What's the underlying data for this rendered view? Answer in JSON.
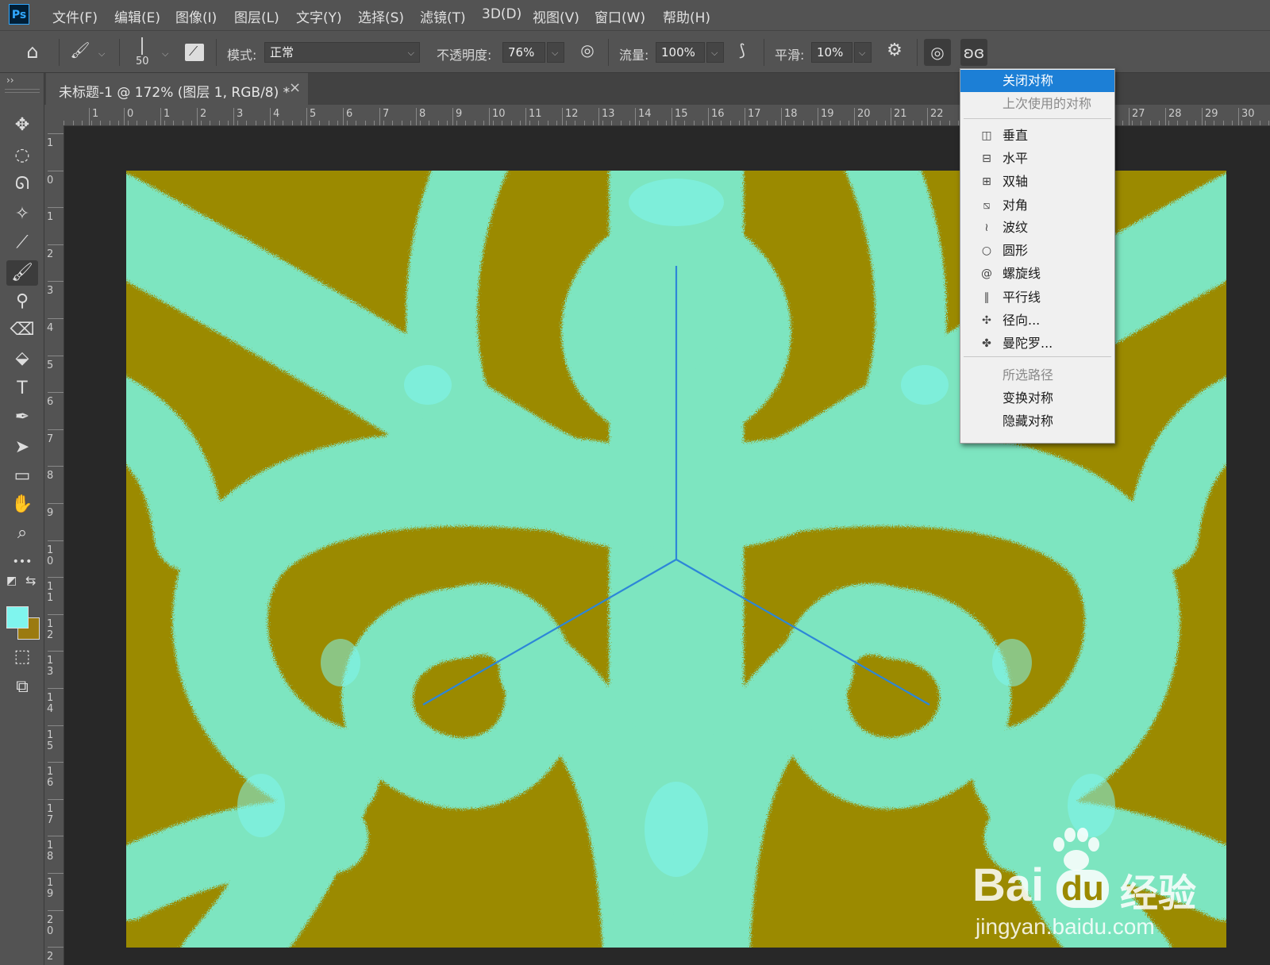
{
  "app": {
    "logo_text": "Ps"
  },
  "menubar": {
    "items": [
      "文件(F)",
      "编辑(E)",
      "图像(I)",
      "图层(L)",
      "文字(Y)",
      "选择(S)",
      "滤镜(T)",
      "3D(D)",
      "视图(V)",
      "窗口(W)",
      "帮助(H)"
    ]
  },
  "options": {
    "brush_size": "50",
    "mode_label": "模式:",
    "mode_value": "正常",
    "opacity_label": "不透明度:",
    "opacity_value": "76%",
    "flow_label": "流量:",
    "flow_value": "100%",
    "smooth_label": "平滑:",
    "smooth_value": "10%"
  },
  "toolbar": {
    "collapse_glyph": "››",
    "tools": [
      {
        "name": "move-tool-icon",
        "glyph": "✥"
      },
      {
        "name": "ellipse-marquee-tool-icon",
        "glyph": "◌"
      },
      {
        "name": "lasso-tool-icon",
        "glyph": "ᘏ"
      },
      {
        "name": "magic-wand-tool-icon",
        "glyph": "✧"
      },
      {
        "name": "eyedropper-tool-icon",
        "glyph": "⟋"
      },
      {
        "name": "brush-tool-icon",
        "glyph": "🖌"
      },
      {
        "name": "stamp-tool-icon",
        "glyph": "⚲"
      },
      {
        "name": "eraser-tool-icon",
        "glyph": "⌫"
      },
      {
        "name": "paint-bucket-tool-icon",
        "glyph": "⬙"
      },
      {
        "name": "type-tool-icon",
        "glyph": "T"
      },
      {
        "name": "pen-tool-icon",
        "glyph": "✒"
      },
      {
        "name": "path-select-tool-icon",
        "glyph": "➤"
      },
      {
        "name": "rectangle-tool-icon",
        "glyph": "▭"
      },
      {
        "name": "hand-tool-icon",
        "glyph": "✋"
      },
      {
        "name": "zoom-tool-icon",
        "glyph": "⌕"
      },
      {
        "name": "more-tools-icon",
        "glyph": "•••"
      }
    ],
    "foreground_color": "#7ff5ee",
    "background_color": "#9b7a10"
  },
  "document": {
    "tab_title": "未标题-1 @ 172% (图层 1, RGB/8) *",
    "close_glyph": "×"
  },
  "rulers": {
    "horizontal": [
      "1",
      "0",
      "1",
      "2",
      "3",
      "4",
      "5",
      "6",
      "7",
      "8",
      "9",
      "10",
      "11",
      "12",
      "13",
      "14",
      "15",
      "16",
      "17",
      "18",
      "19",
      "20",
      "21",
      "22",
      "27",
      "28",
      "29",
      "30"
    ],
    "vertical": [
      "1",
      "0",
      "1",
      "2",
      "3",
      "4",
      "5",
      "6",
      "7",
      "8",
      "9",
      "10",
      "11",
      "12",
      "13",
      "14",
      "15",
      "16",
      "17",
      "18",
      "19",
      "20",
      "2"
    ]
  },
  "colors": {
    "canvas_gold": "#9b8a00",
    "canvas_mint": "#7de5c0",
    "canvas_cyan": "#7ff5ee",
    "symmetry_guide": "#2d86d8",
    "menu_highlight": "#1c7fd6"
  },
  "symmetry_menu": {
    "items": [
      {
        "label": "关闭对称",
        "icon": "",
        "state": "selected"
      },
      {
        "label": "上次使用的对称",
        "icon": "",
        "state": "disabled"
      },
      {
        "label": "垂直",
        "icon": "vertical-symmetry-icon",
        "state": "normal"
      },
      {
        "label": "水平",
        "icon": "horizontal-symmetry-icon",
        "state": "normal"
      },
      {
        "label": "双轴",
        "icon": "dual-axis-symmetry-icon",
        "state": "normal"
      },
      {
        "label": "对角",
        "icon": "diagonal-symmetry-icon",
        "state": "normal"
      },
      {
        "label": "波纹",
        "icon": "wavy-symmetry-icon",
        "state": "normal"
      },
      {
        "label": "圆形",
        "icon": "circle-symmetry-icon",
        "state": "normal"
      },
      {
        "label": "螺旋线",
        "icon": "spiral-symmetry-icon",
        "state": "normal"
      },
      {
        "label": "平行线",
        "icon": "parallel-lines-symmetry-icon",
        "state": "normal"
      },
      {
        "label": "径向...",
        "icon": "radial-symmetry-icon",
        "state": "normal"
      },
      {
        "label": "曼陀罗...",
        "icon": "mandala-symmetry-icon",
        "state": "normal"
      },
      {
        "label": "所选路径",
        "icon": "",
        "state": "disabled"
      },
      {
        "label": "变换对称",
        "icon": "",
        "state": "normal"
      },
      {
        "label": "隐藏对称",
        "icon": "",
        "state": "normal"
      }
    ]
  },
  "watermark": {
    "brand": "Bai",
    "brand_du": "du",
    "brand_cn": "经验",
    "url": "jingyan.baidu.com"
  }
}
